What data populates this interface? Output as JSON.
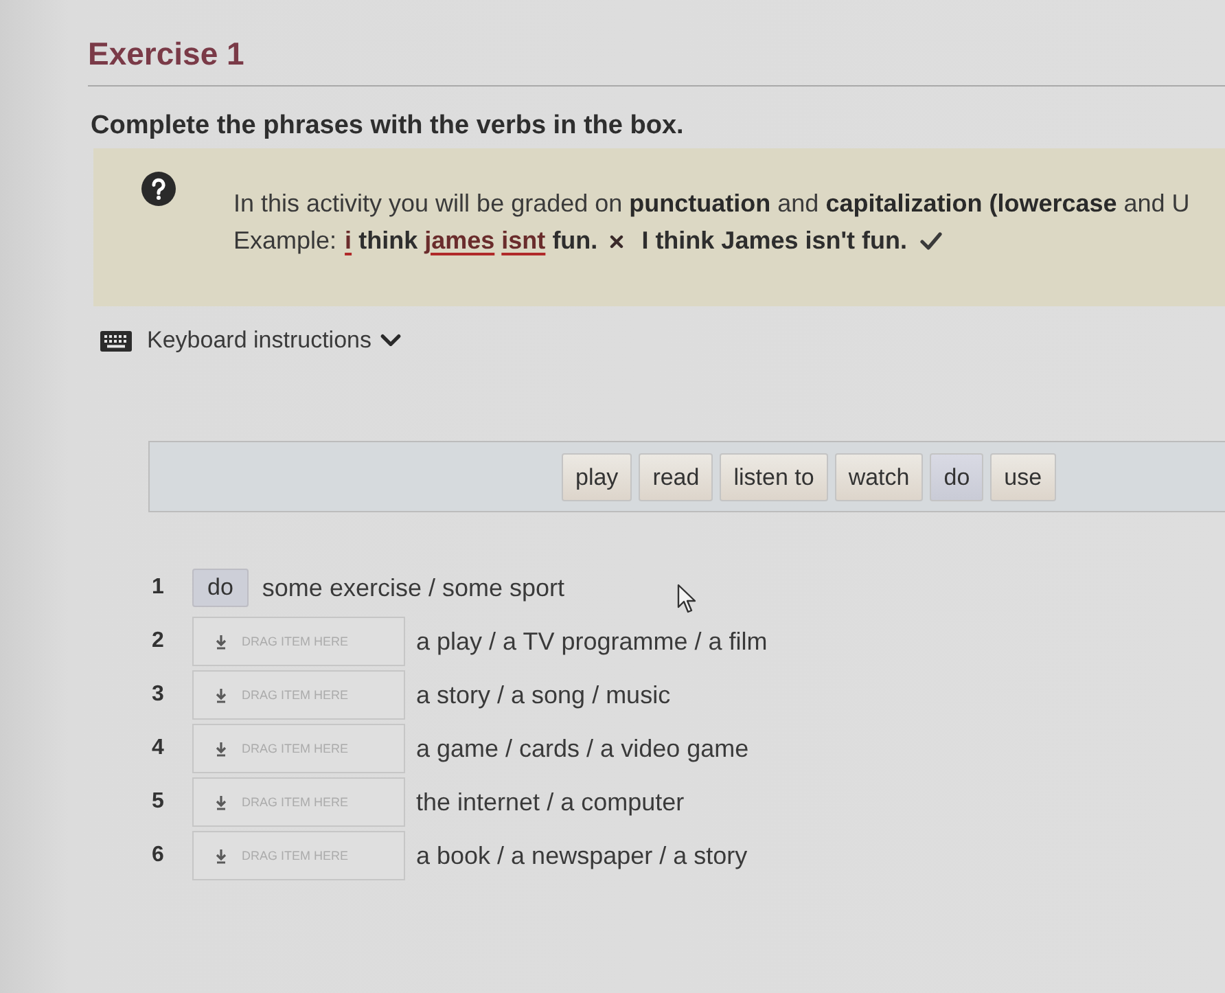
{
  "exercise": {
    "title": "Exercise 1"
  },
  "instruction": "Complete the phrases with the verbs in the box.",
  "info": {
    "text": "In this activity you will be graded on **punctuation** and **capitalization (lowercase** and U",
    "example": {
      "label": "Example:",
      "wrong_words": [
        {
          "text": "i",
          "error": true
        },
        {
          "text": "think",
          "error": false
        },
        {
          "text": "james",
          "error": true
        },
        {
          "text": "isnt",
          "error": true
        },
        {
          "text": "fun.",
          "error": false
        }
      ],
      "correct": "I think James isn't fun."
    }
  },
  "keyboard_instructions": {
    "label": "Keyboard instructions",
    "expanded": false
  },
  "word_bank": [
    {
      "word": "play",
      "used": false
    },
    {
      "word": "read",
      "used": false
    },
    {
      "word": "listen to",
      "used": false
    },
    {
      "word": "watch",
      "used": false
    },
    {
      "word": "do",
      "used": true
    },
    {
      "word": "use",
      "used": false
    }
  ],
  "phrases": [
    {
      "number": "1",
      "answer": "do",
      "phrase": "some exercise / some sport"
    },
    {
      "number": "2",
      "placeholder": "DRAG ITEM HERE",
      "phrase": "a play / a TV programme / a film"
    },
    {
      "number": "3",
      "placeholder": "DRAG ITEM HERE",
      "phrase": "a story / a song / music"
    },
    {
      "number": "4",
      "placeholder": "DRAG ITEM HERE",
      "phrase": "a game / cards / a video game"
    },
    {
      "number": "5",
      "placeholder": "DRAG ITEM HERE",
      "phrase": "the internet / a computer"
    },
    {
      "number": "6",
      "placeholder": "DRAG ITEM HERE",
      "phrase": "a book / a newspaper / a story"
    }
  ]
}
